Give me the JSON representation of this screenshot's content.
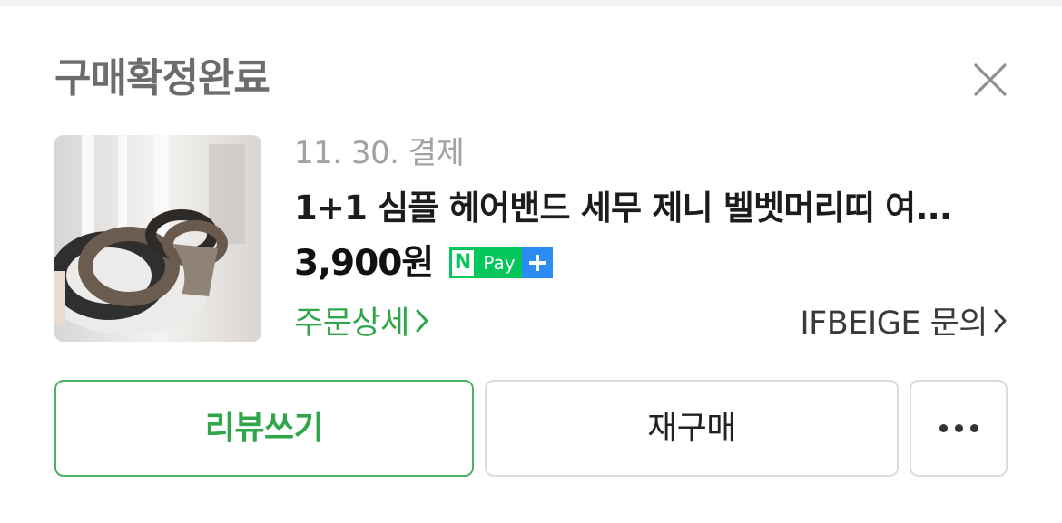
{
  "header": {
    "title": "구매확정완료"
  },
  "order": {
    "date": "11. 30. 결제",
    "product_name": "1+1 심플 헤어밴드 세무 제니 벨벳머리띠 여...",
    "price": "3,900원",
    "npay": {
      "n": "N",
      "pay": "Pay"
    },
    "order_detail_label": "주문상세",
    "seller_inquiry_label": "IFBEIGE 문의"
  },
  "actions": {
    "review_label": "리뷰쓰기",
    "rebuy_label": "재구매"
  },
  "colors": {
    "accent_green": "#2fa64a",
    "npay_green": "#03c75a",
    "npay_blue": "#2b8cf2",
    "title_gray": "#6c6c70"
  },
  "icons": [
    "close-icon",
    "chevron-right-icon",
    "more-icon",
    "npay-plus-icon"
  ]
}
